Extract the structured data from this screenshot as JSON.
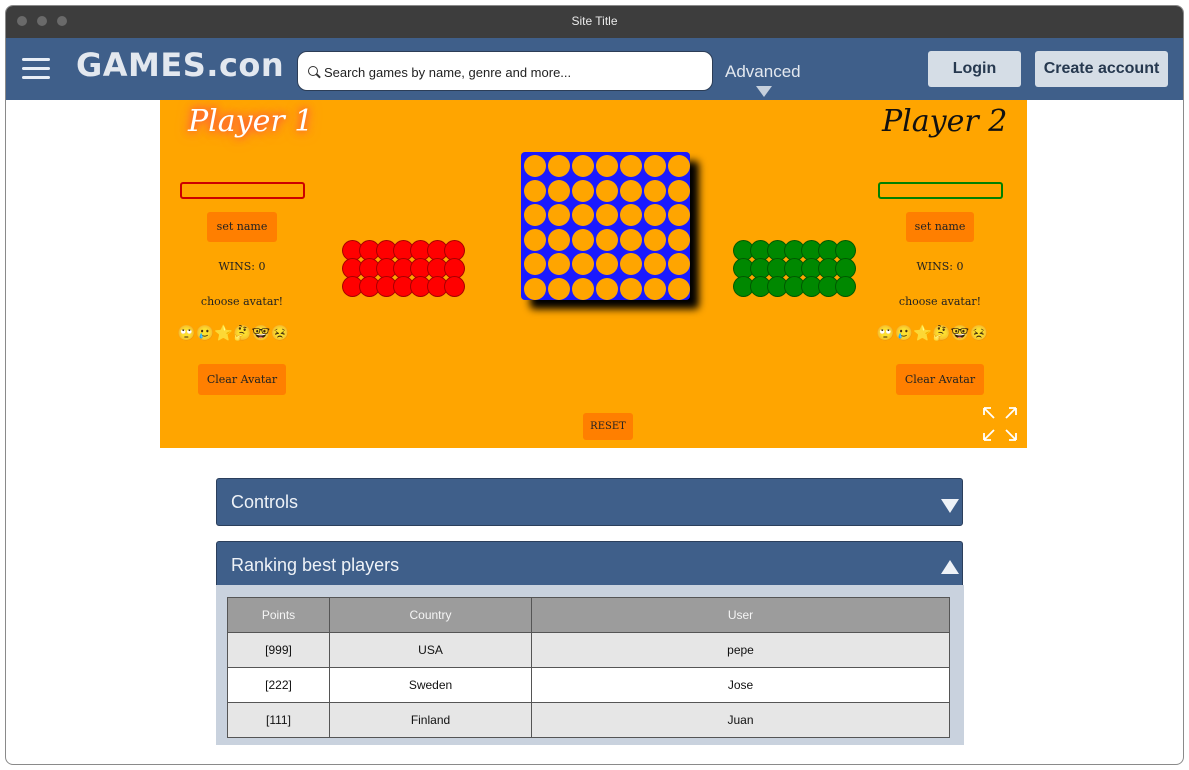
{
  "window": {
    "title": "Site Title"
  },
  "navbar": {
    "logo": "GAMES.con",
    "search_placeholder": "Search games by name, genre and more...",
    "advanced_label": "Advanced",
    "login_label": "Login",
    "create_account_label": "Create account"
  },
  "game": {
    "player1": {
      "title": "Player 1",
      "set_name_label": "set name",
      "wins_label": "WINS: 0",
      "choose_avatar_label": "choose avatar!",
      "avatars": [
        "🙄",
        "🥲",
        "⭐",
        "🤔",
        "🤓",
        "😣"
      ],
      "clear_avatar_label": "Clear Avatar",
      "name_box_color": "#cc0000",
      "chip_color": "#ff0000",
      "chip_count": 21
    },
    "player2": {
      "title": "Player 2",
      "set_name_label": "set name",
      "wins_label": "WINS: 0",
      "choose_avatar_label": "choose avatar!",
      "avatars": [
        "🙄",
        "🥲",
        "⭐",
        "🤔",
        "🤓",
        "😣"
      ],
      "clear_avatar_label": "Clear Avatar",
      "name_box_color": "#008000",
      "chip_color": "#008800",
      "chip_count": 21
    },
    "board": {
      "columns": 7,
      "rows": 6,
      "color": "#1a1aff",
      "hole_color": "#ffa500"
    },
    "reset_label": "RESET",
    "expand_icon": "expand-icon"
  },
  "panels": {
    "controls": {
      "title": "Controls",
      "expanded": false
    },
    "ranking": {
      "title": "Ranking best players",
      "expanded": true,
      "columns": [
        "Points",
        "Country",
        "User"
      ],
      "rows": [
        [
          "[999]",
          "USA",
          "pepe"
        ],
        [
          "[222]",
          "Sweden",
          "Jose"
        ],
        [
          "[111]",
          "Finland",
          "Juan"
        ]
      ]
    }
  },
  "colors": {
    "nav_bg": "#3f5f8a",
    "game_bg": "#ffa500",
    "button_orange": "#ff7f00"
  }
}
